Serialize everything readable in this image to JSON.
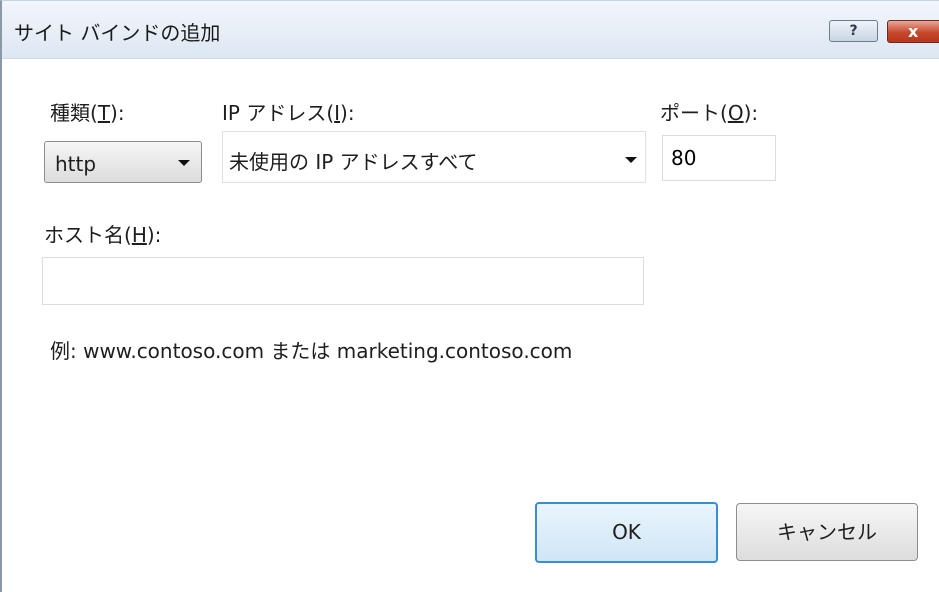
{
  "window": {
    "title": "サイト バインドの追加",
    "help_glyph": "?",
    "close_glyph": "x"
  },
  "type": {
    "label_prefix": "種類(",
    "label_key": "T",
    "label_suffix": "):",
    "value": "http"
  },
  "ip": {
    "label_prefix": "IP アドレス(",
    "label_key": "I",
    "label_suffix": "):",
    "value": "未使用の IP アドレスすべて"
  },
  "port": {
    "label_prefix": "ポート(",
    "label_key": "O",
    "label_suffix": "):",
    "value": "80"
  },
  "host": {
    "label_prefix": "ホスト名(",
    "label_key": "H",
    "label_suffix": "):",
    "value": "",
    "example": "例: www.contoso.com または marketing.contoso.com"
  },
  "buttons": {
    "ok": "OK",
    "cancel": "キャンセル"
  }
}
